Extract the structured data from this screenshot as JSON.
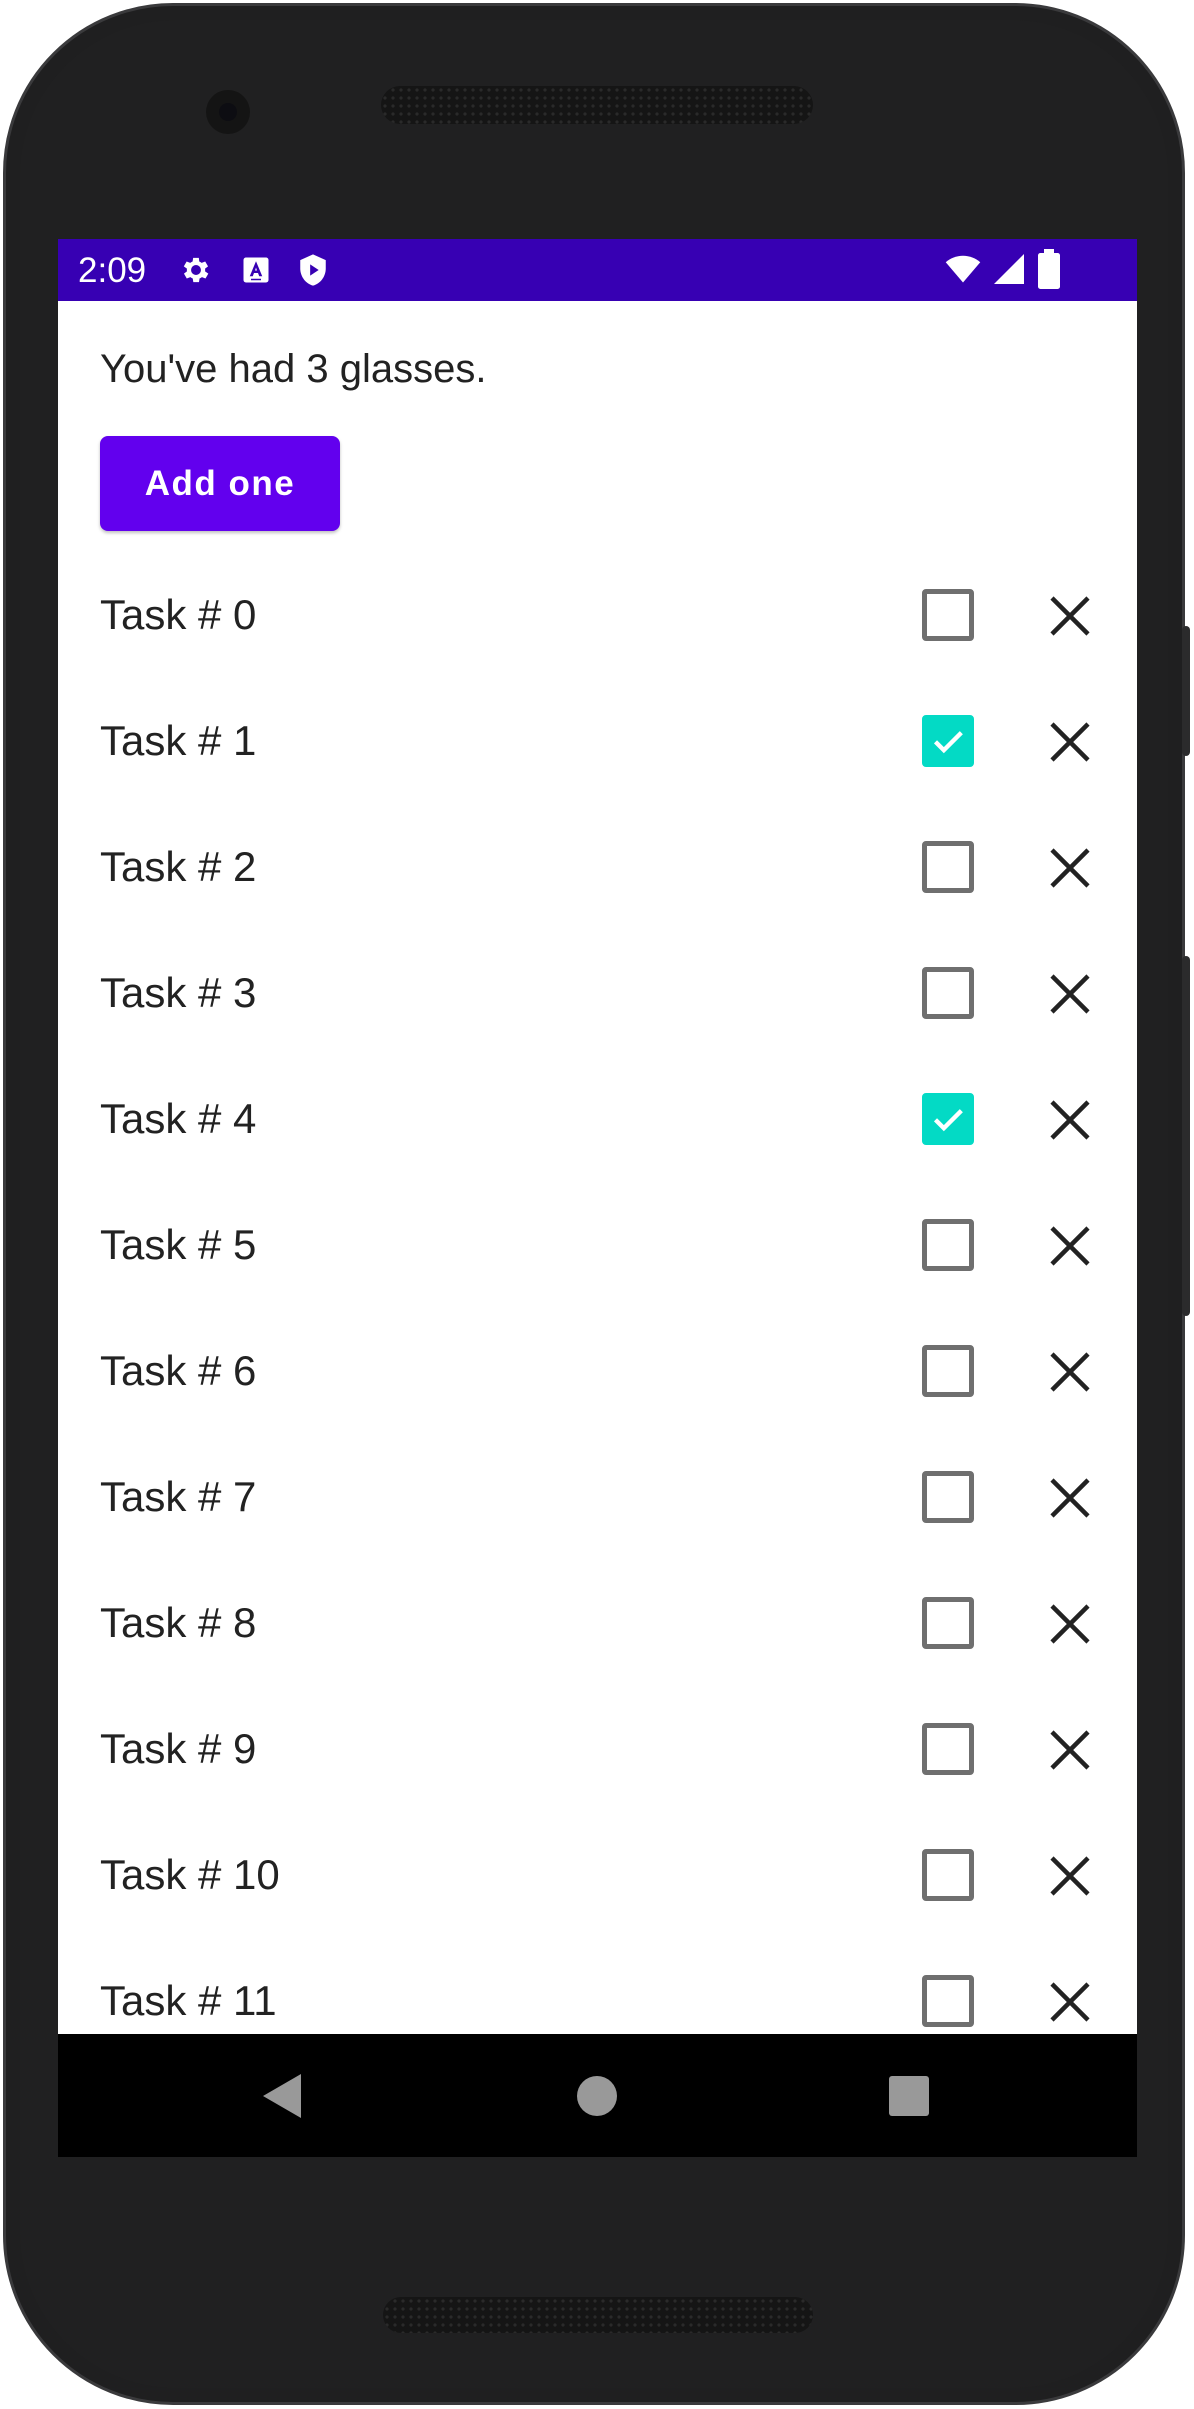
{
  "status_bar": {
    "time": "2:09",
    "left_icons": [
      "gear-icon",
      "accessibility-text-icon",
      "play-protect-icon"
    ],
    "right_icons": [
      "wifi-icon",
      "cell-signal-icon",
      "battery-icon"
    ],
    "background_color": "#3700b3"
  },
  "water": {
    "message": "You've had 3 glasses.",
    "add_button_label": "Add one",
    "button_color": "#6200ee"
  },
  "tasks": [
    {
      "label": "Task # 0",
      "checked": false
    },
    {
      "label": "Task # 1",
      "checked": true
    },
    {
      "label": "Task # 2",
      "checked": false
    },
    {
      "label": "Task # 3",
      "checked": false
    },
    {
      "label": "Task # 4",
      "checked": true
    },
    {
      "label": "Task # 5",
      "checked": false
    },
    {
      "label": "Task # 6",
      "checked": false
    },
    {
      "label": "Task # 7",
      "checked": false
    },
    {
      "label": "Task # 8",
      "checked": false
    },
    {
      "label": "Task # 9",
      "checked": false
    },
    {
      "label": "Task # 10",
      "checked": false
    },
    {
      "label": "Task # 11",
      "checked": false
    }
  ],
  "checkbox_checked_color": "#03dac5",
  "nav_bar": {
    "buttons": [
      "back-icon",
      "home-icon",
      "recents-icon"
    ]
  }
}
